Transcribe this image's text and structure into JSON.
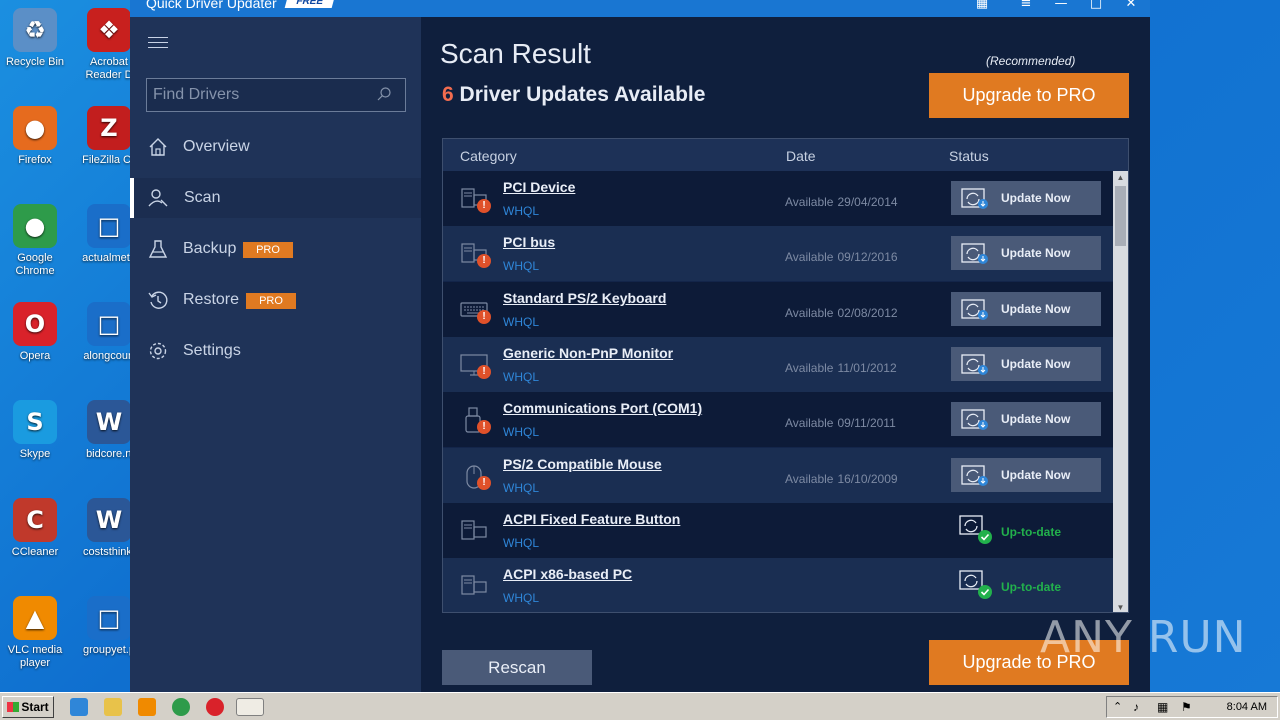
{
  "desktop": {
    "icons": [
      {
        "label": "Recycle Bin",
        "color": "#5b8fc7"
      },
      {
        "label": "Acrobat Reader D",
        "color": "#c8201e"
      },
      {
        "label": "Firefox",
        "color": "#e66b1e"
      },
      {
        "label": "FileZilla Cli",
        "color": "#c21e1e"
      },
      {
        "label": "Google Chrome",
        "color": "#2e9b4a"
      },
      {
        "label": "actualmeta",
        "color": "#1a6ec9"
      },
      {
        "label": "Opera",
        "color": "#d9222a"
      },
      {
        "label": "alongcourt",
        "color": "#1a6ec9"
      },
      {
        "label": "Skype",
        "color": "#1a9be0"
      },
      {
        "label": "bidcore.rt",
        "color": "#2b5797"
      },
      {
        "label": "CCleaner",
        "color": "#c0392b"
      },
      {
        "label": "coststhink.",
        "color": "#2b5797"
      },
      {
        "label": "VLC media player",
        "color": "#f08a00"
      },
      {
        "label": "groupyet.p",
        "color": "#1a6ec9"
      }
    ]
  },
  "window": {
    "title": "Quick Driver Updater",
    "edition_badge": "FREE"
  },
  "sidebar": {
    "search_placeholder": "Find Drivers",
    "items": [
      {
        "label": "Overview",
        "icon": "home-icon"
      },
      {
        "label": "Scan",
        "icon": "scan-icon"
      },
      {
        "label": "Backup",
        "icon": "backup-icon",
        "badge": "PRO"
      },
      {
        "label": "Restore",
        "icon": "restore-icon",
        "badge": "PRO"
      },
      {
        "label": "Settings",
        "icon": "gear-icon"
      }
    ]
  },
  "main": {
    "title": "Scan Result",
    "update_count": "6",
    "update_text": "Driver Updates Available",
    "recommended": "(Recommended)",
    "upgrade_label": "Upgrade to PRO",
    "rescan_label": "Rescan",
    "columns": [
      "Category",
      "Date",
      "Status"
    ],
    "rows": [
      {
        "name": "PCI Device",
        "cert": "WHQL",
        "avail": "Available",
        "date": "29/04/2014",
        "status": "Update Now",
        "icon": "pci-icon",
        "outdated": true
      },
      {
        "name": "PCI bus",
        "cert": "WHQL",
        "avail": "Available",
        "date": "09/12/2016",
        "status": "Update Now",
        "icon": "pci-icon",
        "outdated": true
      },
      {
        "name": "Standard PS/2 Keyboard",
        "cert": "WHQL",
        "avail": "Available",
        "date": "02/08/2012",
        "status": "Update Now",
        "icon": "keyboard-icon",
        "outdated": true
      },
      {
        "name": "Generic Non-PnP Monitor",
        "cert": "WHQL",
        "avail": "Available",
        "date": "11/01/2012",
        "status": "Update Now",
        "icon": "monitor-icon",
        "outdated": true
      },
      {
        "name": "Communications Port (COM1)",
        "cert": "WHQL",
        "avail": "Available",
        "date": "09/11/2011",
        "status": "Update Now",
        "icon": "port-icon",
        "outdated": true
      },
      {
        "name": "PS/2 Compatible Mouse",
        "cert": "WHQL",
        "avail": "Available",
        "date": "16/10/2009",
        "status": "Update Now",
        "icon": "mouse-icon",
        "outdated": true
      },
      {
        "name": "ACPI Fixed Feature Button",
        "cert": "WHQL",
        "avail": "",
        "date": "",
        "status": "Up-to-date",
        "icon": "pci-icon",
        "outdated": false
      },
      {
        "name": "ACPI x86-based PC",
        "cert": "WHQL",
        "avail": "",
        "date": "",
        "status": "Up-to-date",
        "icon": "pci-icon",
        "outdated": false
      }
    ]
  },
  "watermark": "ANY RUN",
  "taskbar": {
    "start_label": "Start",
    "clock": "8:04 AM"
  },
  "colors": {
    "accent": "#e07a21",
    "count": "#f26c4f",
    "whql": "#2f86d8",
    "ok": "#22b14c"
  }
}
